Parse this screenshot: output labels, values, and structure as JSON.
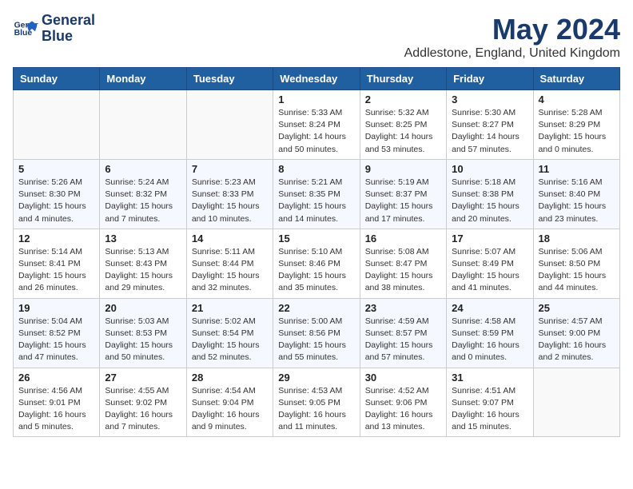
{
  "logo": {
    "line1": "General",
    "line2": "Blue"
  },
  "title": "May 2024",
  "location": "Addlestone, England, United Kingdom",
  "weekdays": [
    "Sunday",
    "Monday",
    "Tuesday",
    "Wednesday",
    "Thursday",
    "Friday",
    "Saturday"
  ],
  "weeks": [
    [
      null,
      null,
      null,
      {
        "day": 1,
        "sunrise": "5:33 AM",
        "sunset": "8:24 PM",
        "daylight": "14 hours and 50 minutes."
      },
      {
        "day": 2,
        "sunrise": "5:32 AM",
        "sunset": "8:25 PM",
        "daylight": "14 hours and 53 minutes."
      },
      {
        "day": 3,
        "sunrise": "5:30 AM",
        "sunset": "8:27 PM",
        "daylight": "14 hours and 57 minutes."
      },
      {
        "day": 4,
        "sunrise": "5:28 AM",
        "sunset": "8:29 PM",
        "daylight": "15 hours and 0 minutes."
      }
    ],
    [
      {
        "day": 5,
        "sunrise": "5:26 AM",
        "sunset": "8:30 PM",
        "daylight": "15 hours and 4 minutes."
      },
      {
        "day": 6,
        "sunrise": "5:24 AM",
        "sunset": "8:32 PM",
        "daylight": "15 hours and 7 minutes."
      },
      {
        "day": 7,
        "sunrise": "5:23 AM",
        "sunset": "8:33 PM",
        "daylight": "15 hours and 10 minutes."
      },
      {
        "day": 8,
        "sunrise": "5:21 AM",
        "sunset": "8:35 PM",
        "daylight": "15 hours and 14 minutes."
      },
      {
        "day": 9,
        "sunrise": "5:19 AM",
        "sunset": "8:37 PM",
        "daylight": "15 hours and 17 minutes."
      },
      {
        "day": 10,
        "sunrise": "5:18 AM",
        "sunset": "8:38 PM",
        "daylight": "15 hours and 20 minutes."
      },
      {
        "day": 11,
        "sunrise": "5:16 AM",
        "sunset": "8:40 PM",
        "daylight": "15 hours and 23 minutes."
      }
    ],
    [
      {
        "day": 12,
        "sunrise": "5:14 AM",
        "sunset": "8:41 PM",
        "daylight": "15 hours and 26 minutes."
      },
      {
        "day": 13,
        "sunrise": "5:13 AM",
        "sunset": "8:43 PM",
        "daylight": "15 hours and 29 minutes."
      },
      {
        "day": 14,
        "sunrise": "5:11 AM",
        "sunset": "8:44 PM",
        "daylight": "15 hours and 32 minutes."
      },
      {
        "day": 15,
        "sunrise": "5:10 AM",
        "sunset": "8:46 PM",
        "daylight": "15 hours and 35 minutes."
      },
      {
        "day": 16,
        "sunrise": "5:08 AM",
        "sunset": "8:47 PM",
        "daylight": "15 hours and 38 minutes."
      },
      {
        "day": 17,
        "sunrise": "5:07 AM",
        "sunset": "8:49 PM",
        "daylight": "15 hours and 41 minutes."
      },
      {
        "day": 18,
        "sunrise": "5:06 AM",
        "sunset": "8:50 PM",
        "daylight": "15 hours and 44 minutes."
      }
    ],
    [
      {
        "day": 19,
        "sunrise": "5:04 AM",
        "sunset": "8:52 PM",
        "daylight": "15 hours and 47 minutes."
      },
      {
        "day": 20,
        "sunrise": "5:03 AM",
        "sunset": "8:53 PM",
        "daylight": "15 hours and 50 minutes."
      },
      {
        "day": 21,
        "sunrise": "5:02 AM",
        "sunset": "8:54 PM",
        "daylight": "15 hours and 52 minutes."
      },
      {
        "day": 22,
        "sunrise": "5:00 AM",
        "sunset": "8:56 PM",
        "daylight": "15 hours and 55 minutes."
      },
      {
        "day": 23,
        "sunrise": "4:59 AM",
        "sunset": "8:57 PM",
        "daylight": "15 hours and 57 minutes."
      },
      {
        "day": 24,
        "sunrise": "4:58 AM",
        "sunset": "8:59 PM",
        "daylight": "16 hours and 0 minutes."
      },
      {
        "day": 25,
        "sunrise": "4:57 AM",
        "sunset": "9:00 PM",
        "daylight": "16 hours and 2 minutes."
      }
    ],
    [
      {
        "day": 26,
        "sunrise": "4:56 AM",
        "sunset": "9:01 PM",
        "daylight": "16 hours and 5 minutes."
      },
      {
        "day": 27,
        "sunrise": "4:55 AM",
        "sunset": "9:02 PM",
        "daylight": "16 hours and 7 minutes."
      },
      {
        "day": 28,
        "sunrise": "4:54 AM",
        "sunset": "9:04 PM",
        "daylight": "16 hours and 9 minutes."
      },
      {
        "day": 29,
        "sunrise": "4:53 AM",
        "sunset": "9:05 PM",
        "daylight": "16 hours and 11 minutes."
      },
      {
        "day": 30,
        "sunrise": "4:52 AM",
        "sunset": "9:06 PM",
        "daylight": "16 hours and 13 minutes."
      },
      {
        "day": 31,
        "sunrise": "4:51 AM",
        "sunset": "9:07 PM",
        "daylight": "16 hours and 15 minutes."
      },
      null
    ]
  ]
}
